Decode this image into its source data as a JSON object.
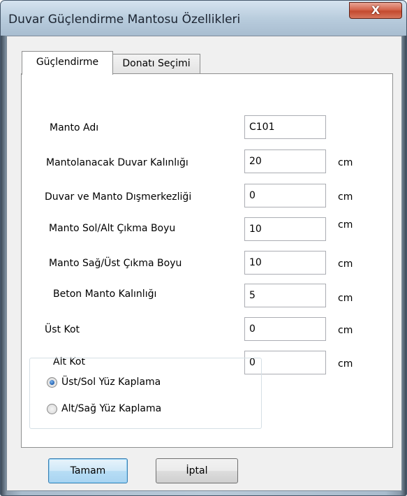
{
  "window": {
    "title": "Duvar Güçlendirme Mantosu Özellikleri",
    "close_label": "X"
  },
  "tabs": [
    {
      "label": "Güçlendirme",
      "active": true
    },
    {
      "label": "Donatı Seçimi",
      "active": false
    }
  ],
  "fields": [
    {
      "label": "Manto Adı",
      "value": "C101",
      "unit": ""
    },
    {
      "label": "Mantolanacak Duvar Kalınlığı",
      "value": "20",
      "unit": "cm"
    },
    {
      "label": "Duvar ve Manto Dışmerkezliği",
      "value": "0",
      "unit": "cm"
    },
    {
      "label": "Manto Sol/Alt Çıkma Boyu",
      "value": "10",
      "unit": "cm"
    },
    {
      "label": "Manto Sağ/Üst Çıkma Boyu",
      "value": "10",
      "unit": "cm"
    },
    {
      "label": "Beton Manto Kalınlığı",
      "value": "5",
      "unit": "cm"
    },
    {
      "label": "Üst Kot",
      "value": "0",
      "unit": "cm"
    },
    {
      "label": "Alt Kot",
      "value": "0",
      "unit": "cm"
    }
  ],
  "radios": [
    {
      "label": "Üst/Sol Yüz Kaplama",
      "checked": true
    },
    {
      "label": "Alt/Sağ Yüz Kaplama",
      "checked": false
    }
  ],
  "buttons": {
    "ok_label": "Tamam",
    "cancel_label": "İptal"
  }
}
